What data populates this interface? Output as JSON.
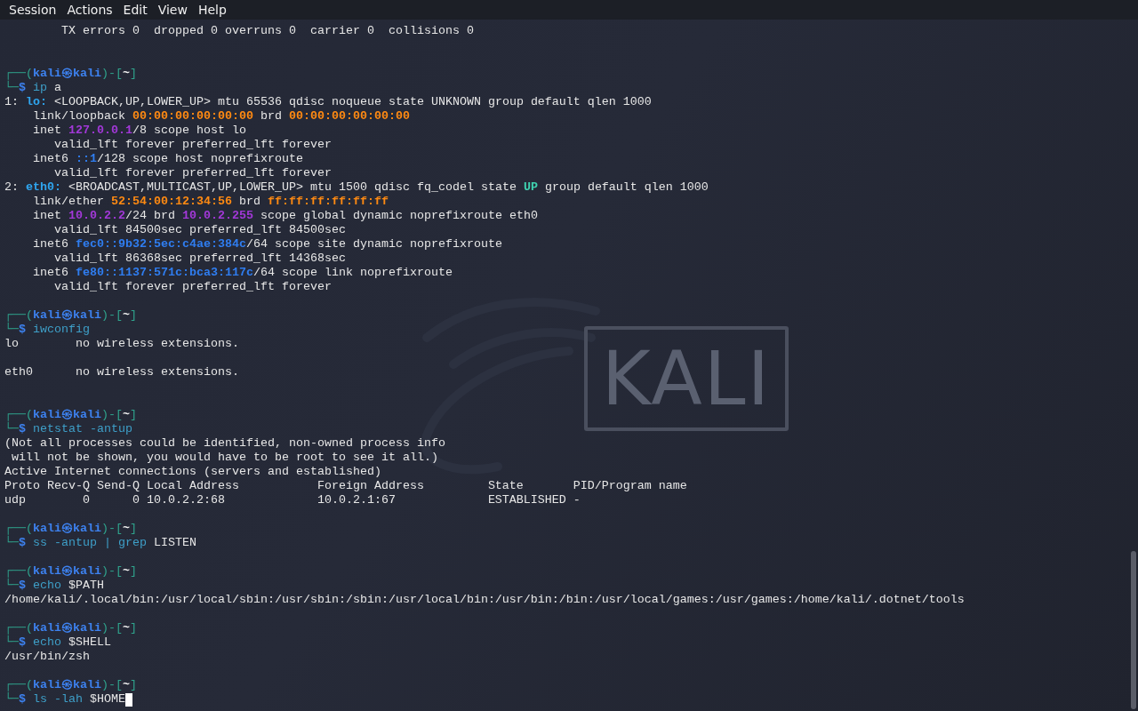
{
  "menu": [
    "Session",
    "Actions",
    "Edit",
    "View",
    "Help"
  ],
  "wallpaper": {
    "logo_text": "KALI"
  },
  "lines": [
    {
      "kind": "output",
      "segments": [
        {
          "kind": "text",
          "text": "        TX errors 0  dropped 0 overruns 0  carrier 0  collisions 0"
        }
      ]
    },
    {
      "kind": "blank"
    },
    {
      "kind": "blank"
    },
    {
      "kind": "prompt",
      "open": "┌──(",
      "user": "kali",
      "at": "㉿",
      "host": "kali",
      "mid": ")-[",
      "dir": "~",
      "close": "]"
    },
    {
      "kind": "command",
      "corner": "└─",
      "sign": "$",
      "cursor": false,
      "segments": [
        {
          "kind": "cmd",
          "text": "ip"
        },
        {
          "kind": "arg",
          "text": " a"
        }
      ]
    },
    {
      "kind": "output",
      "segments": [
        {
          "kind": "text",
          "text": "1: "
        },
        {
          "kind": "iface",
          "text": "lo:"
        },
        {
          "kind": "text",
          "text": " <LOOPBACK,UP,LOWER_UP> mtu 65536 qdisc noqueue state UNKNOWN group default qlen 1000"
        }
      ]
    },
    {
      "kind": "output",
      "segments": [
        {
          "kind": "text",
          "text": "    link/loopback "
        },
        {
          "kind": "mac",
          "text": "00:00:00:00:00:00"
        },
        {
          "kind": "text",
          "text": " brd "
        },
        {
          "kind": "mac",
          "text": "00:00:00:00:00:00"
        }
      ]
    },
    {
      "kind": "output",
      "segments": [
        {
          "kind": "text",
          "text": "    inet "
        },
        {
          "kind": "ipv4",
          "text": "127.0.0.1"
        },
        {
          "kind": "text",
          "text": "/8 scope host lo"
        }
      ]
    },
    {
      "kind": "output",
      "segments": [
        {
          "kind": "text",
          "text": "       valid_lft forever preferred_lft forever"
        }
      ]
    },
    {
      "kind": "output",
      "segments": [
        {
          "kind": "text",
          "text": "    inet6 "
        },
        {
          "kind": "ipv6",
          "text": "::1"
        },
        {
          "kind": "text",
          "text": "/128 scope host noprefixroute"
        }
      ]
    },
    {
      "kind": "output",
      "segments": [
        {
          "kind": "text",
          "text": "       valid_lft forever preferred_lft forever"
        }
      ]
    },
    {
      "kind": "output",
      "segments": [
        {
          "kind": "text",
          "text": "2: "
        },
        {
          "kind": "iface",
          "text": "eth0:"
        },
        {
          "kind": "text",
          "text": " <BROADCAST,MULTICAST,UP,LOWER_UP> mtu 1500 qdisc fq_codel state "
        },
        {
          "kind": "state",
          "text": "UP"
        },
        {
          "kind": "text",
          "text": " group default qlen 1000"
        }
      ]
    },
    {
      "kind": "output",
      "segments": [
        {
          "kind": "text",
          "text": "    link/ether "
        },
        {
          "kind": "mac",
          "text": "52:54:00:12:34:56"
        },
        {
          "kind": "text",
          "text": " brd "
        },
        {
          "kind": "mac",
          "text": "ff:ff:ff:ff:ff:ff"
        }
      ]
    },
    {
      "kind": "output",
      "segments": [
        {
          "kind": "text",
          "text": "    inet "
        },
        {
          "kind": "ipv4",
          "text": "10.0.2.2"
        },
        {
          "kind": "text",
          "text": "/24 brd "
        },
        {
          "kind": "ipv4",
          "text": "10.0.2.255"
        },
        {
          "kind": "text",
          "text": " scope global dynamic noprefixroute eth0"
        }
      ]
    },
    {
      "kind": "output",
      "segments": [
        {
          "kind": "text",
          "text": "       valid_lft 84500sec preferred_lft 84500sec"
        }
      ]
    },
    {
      "kind": "output",
      "segments": [
        {
          "kind": "text",
          "text": "    inet6 "
        },
        {
          "kind": "ipv6",
          "text": "fec0::9b32:5ec:c4ae:384c"
        },
        {
          "kind": "text",
          "text": "/64 scope site dynamic noprefixroute"
        }
      ]
    },
    {
      "kind": "output",
      "segments": [
        {
          "kind": "text",
          "text": "       valid_lft 86368sec preferred_lft 14368sec"
        }
      ]
    },
    {
      "kind": "output",
      "segments": [
        {
          "kind": "text",
          "text": "    inet6 "
        },
        {
          "kind": "ipv6",
          "text": "fe80::1137:571c:bca3:117c"
        },
        {
          "kind": "text",
          "text": "/64 scope link noprefixroute"
        }
      ]
    },
    {
      "kind": "output",
      "segments": [
        {
          "kind": "text",
          "text": "       valid_lft forever preferred_lft forever"
        }
      ]
    },
    {
      "kind": "blank"
    },
    {
      "kind": "prompt",
      "open": "┌──(",
      "user": "kali",
      "at": "㉿",
      "host": "kali",
      "mid": ")-[",
      "dir": "~",
      "close": "]"
    },
    {
      "kind": "command",
      "corner": "└─",
      "sign": "$",
      "cursor": false,
      "segments": [
        {
          "kind": "cmd",
          "text": "iwconfig"
        }
      ]
    },
    {
      "kind": "output",
      "segments": [
        {
          "kind": "text",
          "text": "lo        no wireless extensions."
        }
      ]
    },
    {
      "kind": "blank"
    },
    {
      "kind": "output",
      "segments": [
        {
          "kind": "text",
          "text": "eth0      no wireless extensions."
        }
      ]
    },
    {
      "kind": "blank"
    },
    {
      "kind": "blank"
    },
    {
      "kind": "prompt",
      "open": "┌──(",
      "user": "kali",
      "at": "㉿",
      "host": "kali",
      "mid": ")-[",
      "dir": "~",
      "close": "]"
    },
    {
      "kind": "command",
      "corner": "└─",
      "sign": "$",
      "cursor": false,
      "segments": [
        {
          "kind": "cmd",
          "text": "netstat -antup"
        }
      ]
    },
    {
      "kind": "output",
      "segments": [
        {
          "kind": "text",
          "text": "(Not all processes could be identified, non-owned process info"
        }
      ]
    },
    {
      "kind": "output",
      "segments": [
        {
          "kind": "text",
          "text": " will not be shown, you would have to be root to see it all.)"
        }
      ]
    },
    {
      "kind": "output",
      "segments": [
        {
          "kind": "text",
          "text": "Active Internet connections (servers and established)"
        }
      ]
    },
    {
      "kind": "output",
      "segments": [
        {
          "kind": "text",
          "text": "Proto Recv-Q Send-Q Local Address           Foreign Address         State       PID/Program name"
        }
      ]
    },
    {
      "kind": "output",
      "segments": [
        {
          "kind": "text",
          "text": "udp        0      0 10.0.2.2:68             10.0.2.1:67             ESTABLISHED -"
        }
      ]
    },
    {
      "kind": "blank"
    },
    {
      "kind": "prompt",
      "open": "┌──(",
      "user": "kali",
      "at": "㉿",
      "host": "kali",
      "mid": ")-[",
      "dir": "~",
      "close": "]"
    },
    {
      "kind": "command",
      "corner": "└─",
      "sign": "$",
      "cursor": false,
      "segments": [
        {
          "kind": "cmd",
          "text": "ss -antup | grep"
        },
        {
          "kind": "arg",
          "text": " LISTEN"
        }
      ]
    },
    {
      "kind": "blank"
    },
    {
      "kind": "prompt",
      "open": "┌──(",
      "user": "kali",
      "at": "㉿",
      "host": "kali",
      "mid": ")-[",
      "dir": "~",
      "close": "]"
    },
    {
      "kind": "command",
      "corner": "└─",
      "sign": "$",
      "cursor": false,
      "segments": [
        {
          "kind": "cmd",
          "text": "echo"
        },
        {
          "kind": "arg",
          "text": " $PATH"
        }
      ]
    },
    {
      "kind": "output",
      "segments": [
        {
          "kind": "text",
          "text": "/home/kali/.local/bin:/usr/local/sbin:/usr/sbin:/sbin:/usr/local/bin:/usr/bin:/bin:/usr/local/games:/usr/games:/home/kali/.dotnet/tools"
        }
      ]
    },
    {
      "kind": "blank"
    },
    {
      "kind": "prompt",
      "open": "┌──(",
      "user": "kali",
      "at": "㉿",
      "host": "kali",
      "mid": ")-[",
      "dir": "~",
      "close": "]"
    },
    {
      "kind": "command",
      "corner": "└─",
      "sign": "$",
      "cursor": false,
      "segments": [
        {
          "kind": "cmd",
          "text": "echo"
        },
        {
          "kind": "arg",
          "text": " $SHELL"
        }
      ]
    },
    {
      "kind": "output",
      "segments": [
        {
          "kind": "text",
          "text": "/usr/bin/zsh"
        }
      ]
    },
    {
      "kind": "blank"
    },
    {
      "kind": "prompt",
      "open": "┌──(",
      "user": "kali",
      "at": "㉿",
      "host": "kali",
      "mid": ")-[",
      "dir": "~",
      "close": "]"
    },
    {
      "kind": "command",
      "corner": "└─",
      "sign": "$",
      "cursor": true,
      "segments": [
        {
          "kind": "cmd",
          "text": "ls -lah"
        },
        {
          "kind": "arg",
          "text": " $HOME"
        }
      ]
    }
  ]
}
